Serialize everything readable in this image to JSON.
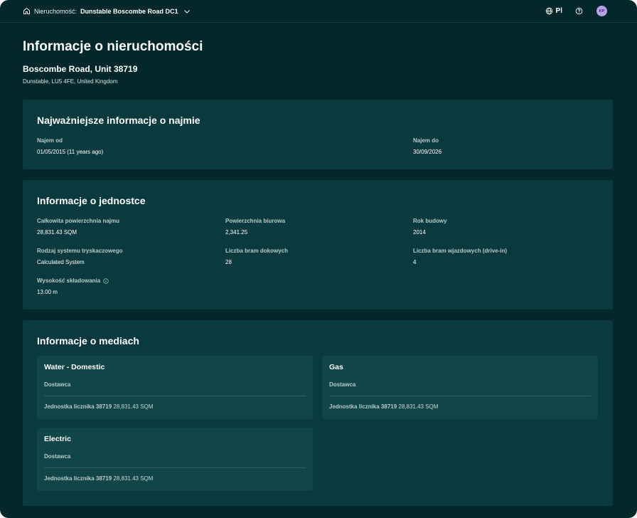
{
  "topbar": {
    "breadcrumb_label": "Nieruchomość:",
    "breadcrumb_value": "Dunstable Boscombe Road DC1",
    "language": "Pl",
    "avatar_initials": "KP"
  },
  "header": {
    "title": "Informacje o nieruchomości",
    "address_line": "Boscombe Road, Unit 38719",
    "address_sub": "Dunstable, LU5 4FE, United Kingdom"
  },
  "lease": {
    "title": "Najważniejsze informacje o najmie",
    "fields": [
      {
        "label": "Najem od",
        "value": "01/05/2015 (11 years ago)"
      },
      {
        "label": "Najem do",
        "value": "30/09/2026"
      }
    ]
  },
  "unit": {
    "title": "Informacje o jednostce",
    "fields": [
      {
        "label": "Całkowita powierzchnia najmu",
        "value": "28,831.43 SQM"
      },
      {
        "label": "Powierzchnia biurowa",
        "value": "2,341.25"
      },
      {
        "label": "Rok budowy",
        "value": "2014"
      },
      {
        "label": "Rodzaj systemu tryskaczowego",
        "value": "Calculated System"
      },
      {
        "label": "Liczba bram dokowych",
        "value": "28"
      },
      {
        "label": "Liczba bram wjazdowych (drive-in)",
        "value": "4"
      },
      {
        "label": "Wysokość składowania",
        "value": "13.00 m"
      }
    ]
  },
  "utilities": {
    "title": "Informacje o mediach",
    "items": [
      {
        "name": "Water - Domestic",
        "supplier_label": "Dostawca",
        "meter_label": "Jednostka licznika 38719",
        "meter_value": "28,831.43 SQM"
      },
      {
        "name": "Gas",
        "supplier_label": "Dostawca",
        "meter_label": "Jednostka licznika 38719",
        "meter_value": "28,831.43 SQM"
      },
      {
        "name": "Electric",
        "supplier_label": "Dostawca",
        "meter_label": "Jednostka licznika 38719",
        "meter_value": "28,831.43 SQM"
      }
    ]
  },
  "icons": [
    "home-icon",
    "chevron-down-icon",
    "globe-icon",
    "help-icon",
    "info-icon"
  ],
  "colors": {
    "background": "#03282b",
    "card": "#0a3a3d",
    "tile": "#104648",
    "avatar": "#b7a0e6"
  }
}
